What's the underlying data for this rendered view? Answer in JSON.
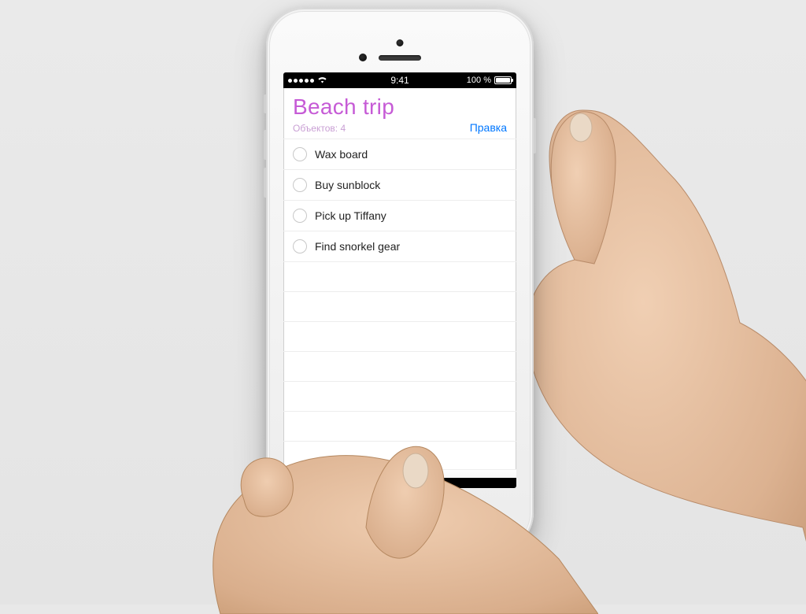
{
  "statusbar": {
    "time": "9:41",
    "battery_label": "100 %"
  },
  "header": {
    "title": "Beach trip",
    "count_label": "Объектов: 4",
    "edit_label": "Правка"
  },
  "items": [
    {
      "label": "Wax board"
    },
    {
      "label": "Buy sunblock"
    },
    {
      "label": "Pick up Tiffany"
    },
    {
      "label": "Find snorkel gear"
    }
  ],
  "colors": {
    "accent_purple": "#c65bd6",
    "link_blue": "#0077ff"
  }
}
